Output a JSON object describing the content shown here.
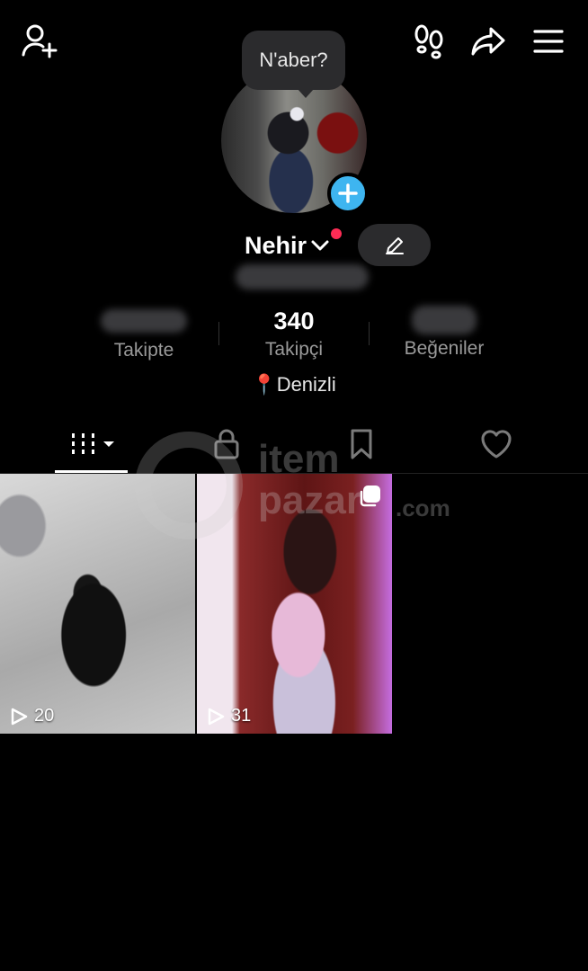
{
  "header": {
    "add_friend_icon": "person-add-icon",
    "footprints_icon": "footprints-icon",
    "share_icon": "share-icon",
    "menu_icon": "hamburger-menu-icon"
  },
  "profile": {
    "status_bubble": "N'aber?",
    "name": "Nehir",
    "accent_color": "#3eb5f0",
    "notification_dot_color": "#fe2c55"
  },
  "stats": [
    {
      "value": "",
      "label": "Takipte"
    },
    {
      "value": "340",
      "label": "Takipçi"
    },
    {
      "value": "",
      "label": "Beğeniler"
    }
  ],
  "location": {
    "pin": "📍",
    "text": "Denizli"
  },
  "tabs": [
    {
      "name": "videos",
      "icon": "grid-icon",
      "active": true
    },
    {
      "name": "private",
      "icon": "lock-icon",
      "active": false
    },
    {
      "name": "saved",
      "icon": "bookmark-icon",
      "active": false
    },
    {
      "name": "liked",
      "icon": "heart-icon",
      "active": false
    }
  ],
  "videos": [
    {
      "views": "20"
    },
    {
      "views": "31"
    }
  ],
  "watermark": {
    "line1": "item",
    "line2": "pazar",
    "suffix": ".com"
  }
}
